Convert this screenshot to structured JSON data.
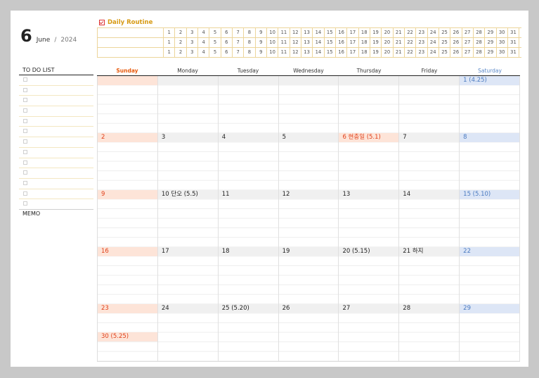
{
  "header": {
    "month_num": "6",
    "month_name": "June",
    "sep": "/",
    "year": "2024"
  },
  "routine": {
    "title": "Daily Routine",
    "days": [
      "1",
      "2",
      "3",
      "4",
      "5",
      "6",
      "7",
      "8",
      "9",
      "10",
      "11",
      "12",
      "13",
      "14",
      "15",
      "16",
      "17",
      "18",
      "19",
      "20",
      "21",
      "22",
      "23",
      "24",
      "25",
      "26",
      "27",
      "28",
      "29",
      "30",
      "31"
    ]
  },
  "todo": {
    "title": "TO DO LIST"
  },
  "memo": {
    "title": "MEMO"
  },
  "calendar": {
    "dow": [
      "Sunday",
      "Monday",
      "Tuesday",
      "Wednesday",
      "Thursday",
      "Friday",
      "Saturday"
    ],
    "weeks": [
      [
        "",
        "",
        "",
        "",
        "",
        "",
        "1 (4.25)"
      ],
      [
        "2",
        "3",
        "4",
        "5",
        "6 현충일 (5.1)",
        "7",
        "8"
      ],
      [
        "9",
        "10 단오 (5.5)",
        "11",
        "12",
        "13",
        "14",
        "15 (5.10)"
      ],
      [
        "16",
        "17",
        "18",
        "19",
        "20 (5.15)",
        "21 하지",
        "22"
      ],
      [
        "23",
        "24",
        "25 (5.20)",
        "26",
        "27",
        "28",
        "29"
      ]
    ],
    "extra": "30 (5.25)"
  }
}
